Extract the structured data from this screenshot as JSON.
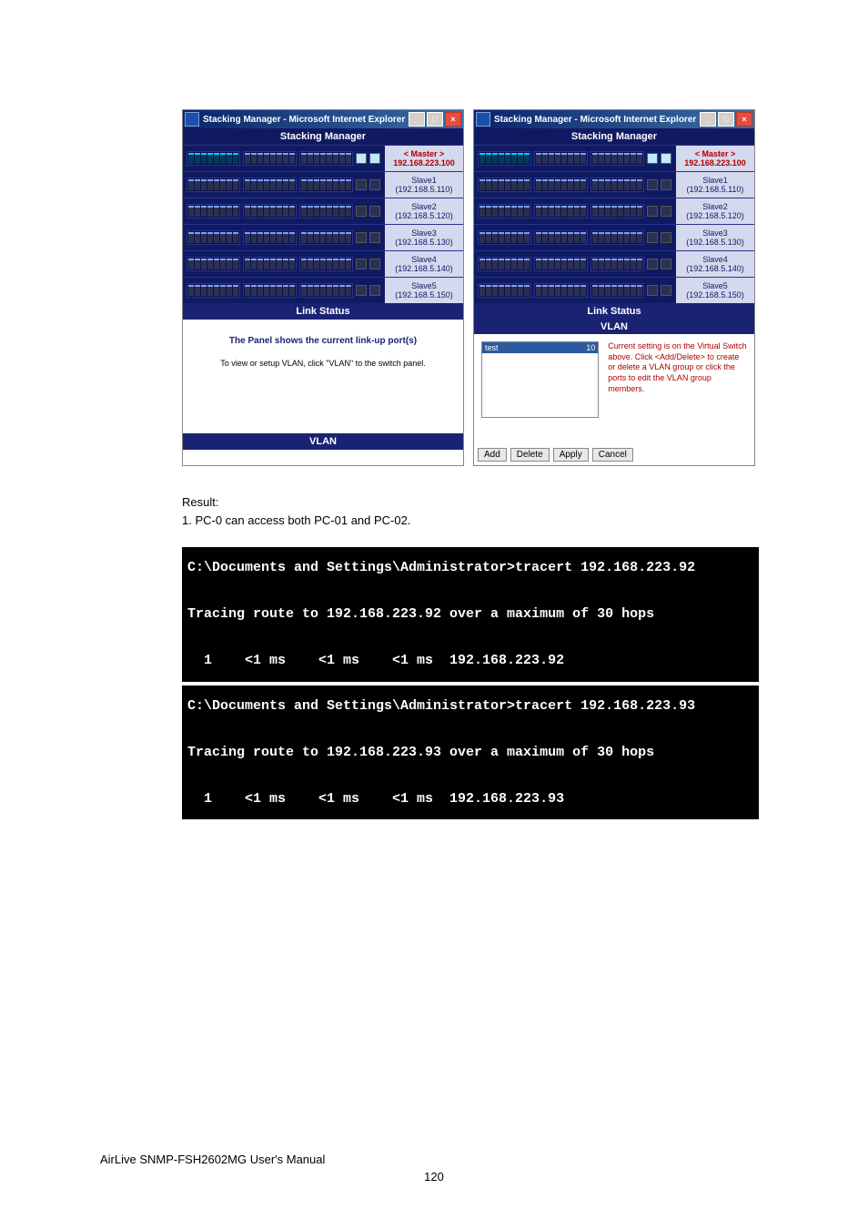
{
  "windowA": {
    "title": "Stacking Manager - Microsoft Internet Explorer",
    "header": "Stacking Manager",
    "rows": [
      {
        "name": "< Master >",
        "ip": "192.168.223.100",
        "master": true
      },
      {
        "name": "Slave1",
        "ip": "(192.168.5.110)",
        "master": false
      },
      {
        "name": "Slave2",
        "ip": "(192.168.5.120)",
        "master": false
      },
      {
        "name": "Slave3",
        "ip": "(192.168.5.130)",
        "master": false
      },
      {
        "name": "Slave4",
        "ip": "(192.168.5.140)",
        "master": false
      },
      {
        "name": "Slave5",
        "ip": "(192.168.5.150)",
        "master": false
      }
    ],
    "link_status": "Link Status",
    "msg1": "The Panel shows the current link-up port(s)",
    "msg2": "To view or setup VLAN, click \"VLAN\" to the switch panel.",
    "vlan_btn": "VLAN"
  },
  "windowB": {
    "title": "Stacking Manager - Microsoft Internet Explorer",
    "header": "Stacking Manager",
    "rows": [
      {
        "name": "< Master >",
        "ip": "192.168.223.100",
        "master": true
      },
      {
        "name": "Slave1",
        "ip": "(192.168.5.110)",
        "master": false
      },
      {
        "name": "Slave2",
        "ip": "(192.168.5.120)",
        "master": false
      },
      {
        "name": "Slave3",
        "ip": "(192.168.5.130)",
        "master": false
      },
      {
        "name": "Slave4",
        "ip": "(192.168.5.140)",
        "master": false
      },
      {
        "name": "Slave5",
        "ip": "(192.168.5.150)",
        "master": false
      }
    ],
    "link_status": "Link Status",
    "vlan_head": "VLAN",
    "vlan_item_name": "test",
    "vlan_item_id": "10",
    "vlan_info": "Current setting is on the Virtual Switch above. Click <Add/Delete> to create or delete a VLAN group or click the ports to edit the VLAN group members.",
    "btns": {
      "add": "Add",
      "delete": "Delete",
      "apply": "Apply",
      "cancel": "Cancel"
    }
  },
  "result": {
    "heading": "Result:",
    "line1": "1. PC-0 can access both PC-01 and PC-02."
  },
  "term1": "C:\\Documents and Settings\\Administrator>tracert 192.168.223.92\n\nTracing route to 192.168.223.92 over a maximum of 30 hops\n\n  1    <1 ms    <1 ms    <1 ms  192.168.223.92",
  "term2": "C:\\Documents and Settings\\Administrator>tracert 192.168.223.93\n\nTracing route to 192.168.223.93 over a maximum of 30 hops\n\n  1    <1 ms    <1 ms    <1 ms  192.168.223.93",
  "footer": {
    "product": "AirLive SNMP-FSH2602MG User's Manual",
    "page": "120"
  }
}
